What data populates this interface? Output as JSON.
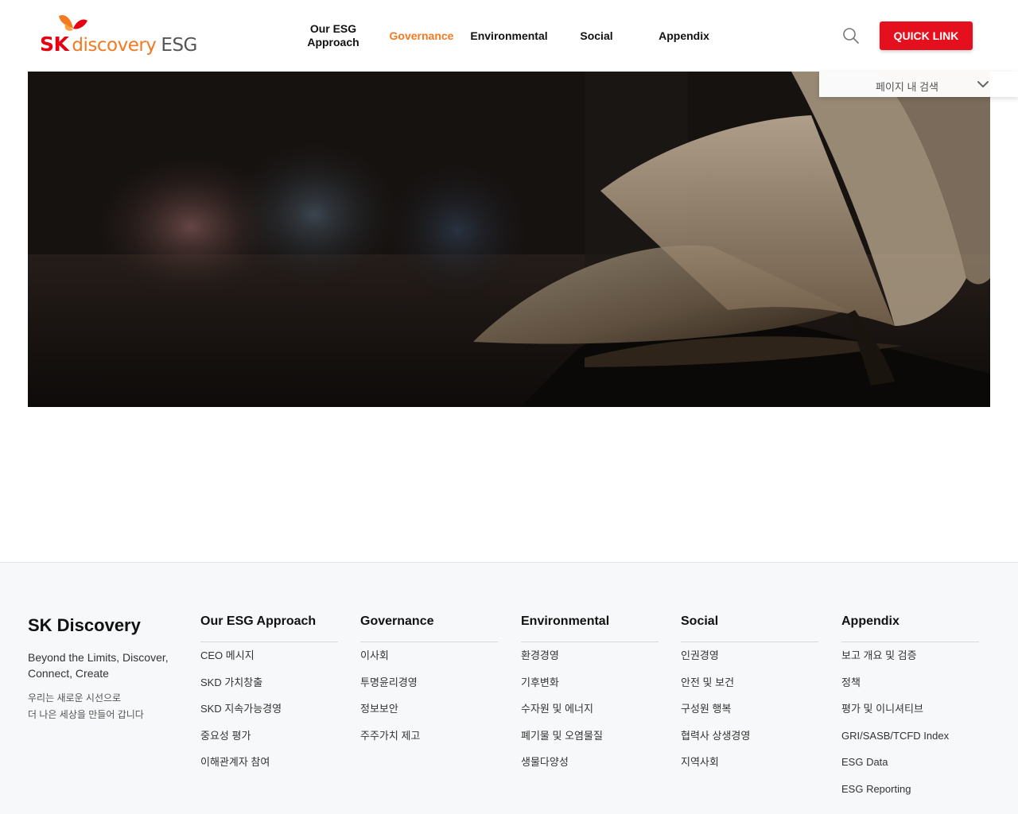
{
  "header": {
    "logo": {
      "sk": "SK",
      "discovery": "discovery",
      "esg": "ESG"
    },
    "nav": [
      {
        "label": "Our ESG\nApproach",
        "active": false
      },
      {
        "label": "Governance",
        "active": true
      },
      {
        "label": "Environmental",
        "active": false
      },
      {
        "label": "Social",
        "active": false
      },
      {
        "label": "Appendix",
        "active": false
      }
    ],
    "search_icon": "search-icon",
    "quick_link_label": "QUICK LINK"
  },
  "page_search": {
    "label": "페이지 내 검색",
    "icon": "chevron-down-icon"
  },
  "hero": {
    "image": "open-book-photo"
  },
  "footer": {
    "brand": "SK Discovery",
    "tagline": "Beyond the Limits, Discover, Connect, Create",
    "korean_line1": "우리는 새로운 시선으로",
    "korean_line2": "더 나은 세상을 만들어 갑니다",
    "columns": [
      {
        "title": "Our ESG Approach",
        "links": [
          "CEO 메시지",
          "SKD 가치창출",
          "SKD 지속가능경영",
          "중요성 평가",
          "이해관계자 참여"
        ]
      },
      {
        "title": "Governance",
        "links": [
          "이사회",
          "투명윤리경영",
          "정보보안",
          "주주가치 제고"
        ]
      },
      {
        "title": "Environmental",
        "links": [
          "환경경영",
          "기후변화",
          "수자원 및 에너지",
          "폐기물 및 오염물질",
          "생물다양성"
        ]
      },
      {
        "title": "Social",
        "links": [
          "인권경영",
          "안전 및 보건",
          "구성원 행복",
          "협력사 상생경영",
          "지역사회"
        ]
      },
      {
        "title": "Appendix",
        "links": [
          "보고 개요 및 검증",
          "정책",
          "평가 및 이니셔티브",
          "GRI/SASB/TCFD Index",
          "ESG Data",
          "ESG Reporting"
        ]
      }
    ]
  },
  "colors": {
    "accent_orange": "#f47920",
    "brand_red": "#e5101d",
    "footer_bg": "#f6f8f9"
  }
}
